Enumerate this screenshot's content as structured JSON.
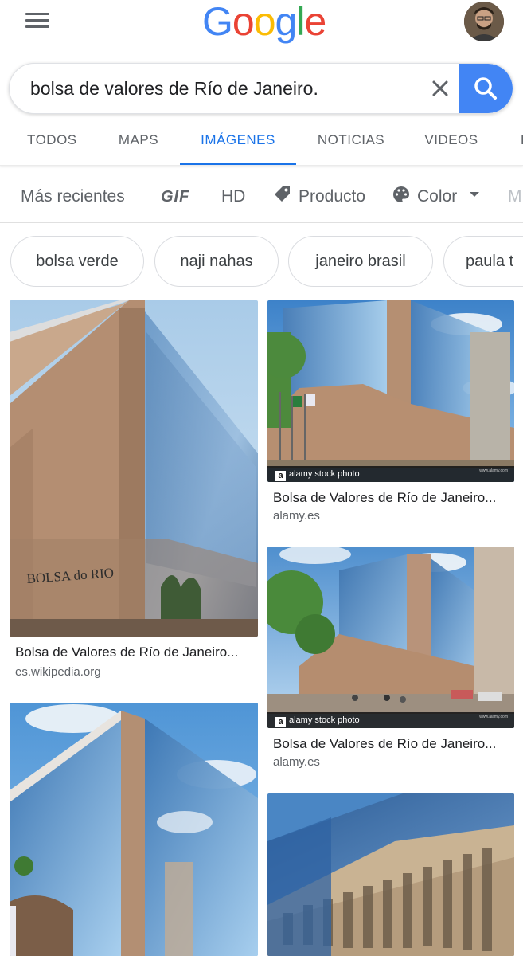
{
  "header": {
    "logo_letters": [
      "G",
      "o",
      "o",
      "g",
      "l",
      "e"
    ],
    "menu_icon": "hamburger-menu-icon",
    "avatar": "profile-avatar"
  },
  "search": {
    "query": "bolsa de valores de Río de Janeiro.",
    "clear_icon": "close-icon",
    "search_icon": "search-icon",
    "accent": "#4285f4"
  },
  "tabs": [
    {
      "label": "TODOS",
      "active": false
    },
    {
      "label": "MAPS",
      "active": false
    },
    {
      "label": "IMÁGENES",
      "active": true
    },
    {
      "label": "NOTICIAS",
      "active": false
    },
    {
      "label": "VIDEOS",
      "active": false
    },
    {
      "label": "L",
      "active": false
    }
  ],
  "filters": {
    "recent": "Más recientes",
    "gif": "GIF",
    "hd": "HD",
    "product": "Producto",
    "color": "Color",
    "more": "M"
  },
  "chips": [
    "bolsa verde",
    "naji nahas",
    "janeiro brasil",
    "paula t"
  ],
  "results": [
    {
      "title": "Bolsa de Valores de Río de Janeiro...",
      "source": "es.wikipedia.org",
      "building_sign": "BOLSA do RIO"
    },
    {
      "title": "Bolsa de Valores de Río de Janeiro...",
      "source": "alamy.es",
      "watermark": "alamy stock photo"
    },
    {
      "title": "Bolsa de Valores de Río de Janeiro...",
      "source": "alamy.es",
      "watermark": "alamy stock photo"
    }
  ],
  "colors": {
    "active_tab": "#1a73e8",
    "text_secondary": "#5f6368"
  }
}
